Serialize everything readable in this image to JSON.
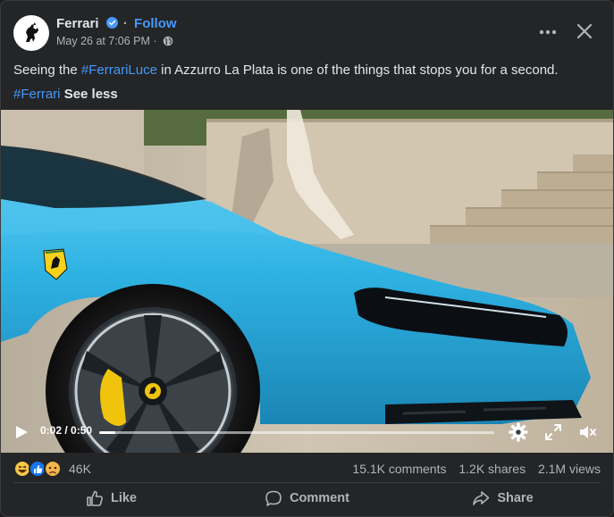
{
  "post": {
    "page_name": "Ferrari",
    "follow_label": "Follow",
    "timestamp": "May 26 at 7:06 PM",
    "caption_text_1": "Seeing the ",
    "caption_hashtag_1": "#FerrariLuce",
    "caption_text_2": " in Azzurro La Plata is one of the things that stops you for a second.",
    "caption_hashtag_2": "#Ferrari",
    "see_less": "See less"
  },
  "video": {
    "time_display": "0:02 / 0:50",
    "progress": 0.04,
    "icons": [
      "play-icon",
      "gear-icon",
      "expand-icon",
      "mute-icon"
    ]
  },
  "stats": {
    "reaction_count": "46K",
    "comments": "15.1K comments",
    "shares": "1.2K shares",
    "views": "2.1M views",
    "reaction_icons": [
      "laugh-reaction-icon",
      "like-reaction-icon",
      "sad-reaction-icon"
    ]
  },
  "actions": {
    "like": "Like",
    "comment": "Comment",
    "share": "Share"
  },
  "colors": {
    "accent": "#4599ff",
    "background": "#242526",
    "text_primary": "#e4e6eb",
    "text_secondary": "#b0b3b8",
    "car_blue": "#2fb3e4"
  }
}
